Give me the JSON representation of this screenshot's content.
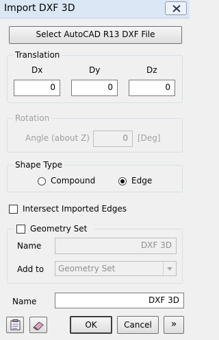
{
  "window": {
    "title": "Import DXF 3D"
  },
  "select_file_button": "Select AutoCAD R13 DXF File",
  "translation": {
    "legend": "Translation",
    "dx_label": "Dx",
    "dy_label": "Dy",
    "dz_label": "Dz",
    "dx": "0",
    "dy": "0",
    "dz": "0"
  },
  "rotation": {
    "legend": "Rotation",
    "angle_label": "Angle (about Z)",
    "angle": "0",
    "unit": "[Deg]"
  },
  "shape_type": {
    "legend": "Shape Type",
    "options": [
      "Compound",
      "Edge"
    ],
    "selected": "Edge"
  },
  "intersect_label": "Intersect Imported Edges",
  "geometry_set": {
    "legend": "Geometry Set",
    "name_label": "Name",
    "name_value": "DXF 3D",
    "add_to_label": "Add to",
    "add_to_value": "Geometry Set"
  },
  "name_label": "Name",
  "name_value": "DXF 3D",
  "buttons": {
    "ok": "OK",
    "cancel": "Cancel",
    "more": "»"
  },
  "icons": [
    "clipboard-icon",
    "eraser-icon"
  ],
  "colors": {
    "titlebar": "#dbe7f5",
    "background": "#f0f0f0",
    "disabled_text": "#a0a0a0"
  }
}
